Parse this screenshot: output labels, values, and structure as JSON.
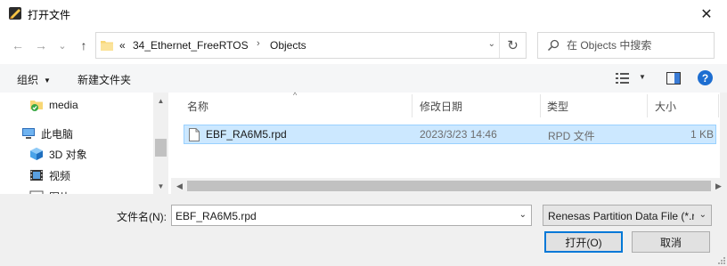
{
  "window": {
    "title": "打开文件",
    "close_glyph": "✕"
  },
  "nav": {
    "back_glyph": "←",
    "forward_glyph": "→",
    "recent_glyph": "⌄",
    "up_glyph": "↑"
  },
  "address": {
    "overflow": "«",
    "segments": [
      "34_Ethernet_FreeRTOS",
      "Objects"
    ],
    "separator": "›",
    "dropdown_glyph": "⌄",
    "refresh_glyph": "↻"
  },
  "search": {
    "placeholder": "在 Objects 中搜索"
  },
  "toolbar": {
    "organize_label": "组织",
    "organize_caret": "▼",
    "new_folder_label": "新建文件夹",
    "view_caret": "▼",
    "help_glyph": "?"
  },
  "nav_tree": {
    "items": [
      {
        "label": "media",
        "icon": "folder-sync-icon"
      },
      {
        "label": "此电脑",
        "icon": "computer-icon"
      },
      {
        "label": "3D 对象",
        "icon": "3d-objects-icon"
      },
      {
        "label": "视频",
        "icon": "video-icon"
      },
      {
        "label": "图片",
        "icon": "pictures-icon"
      }
    ],
    "scroll_up_glyph": "▲",
    "scroll_down_glyph": "▼"
  },
  "file_list": {
    "sort_glyph": "^",
    "columns": {
      "name": "名称",
      "modified": "修改日期",
      "type": "类型",
      "size": "大小"
    },
    "rows": [
      {
        "name": "EBF_RA6M5.rpd",
        "modified": "2023/3/23 14:46",
        "type": "RPD 文件",
        "size": "1 KB"
      }
    ],
    "scroll_left_glyph": "◀",
    "scroll_right_glyph": "▶"
  },
  "footer": {
    "filename_label": "文件名(N):",
    "filename_value": "EBF_RA6M5.rpd",
    "filename_caret": "⌄",
    "filter_value": "Renesas Partition Data File (*.rpd)",
    "filter_caret": "⌄",
    "open_label": "打开(O)",
    "cancel_label": "取消"
  },
  "colors": {
    "selection_bg": "#cce8ff",
    "selection_border": "#99d1ff",
    "accent": "#0078d7",
    "help_blue": "#1d6ed1",
    "folder_yellow": "#f8d775"
  }
}
